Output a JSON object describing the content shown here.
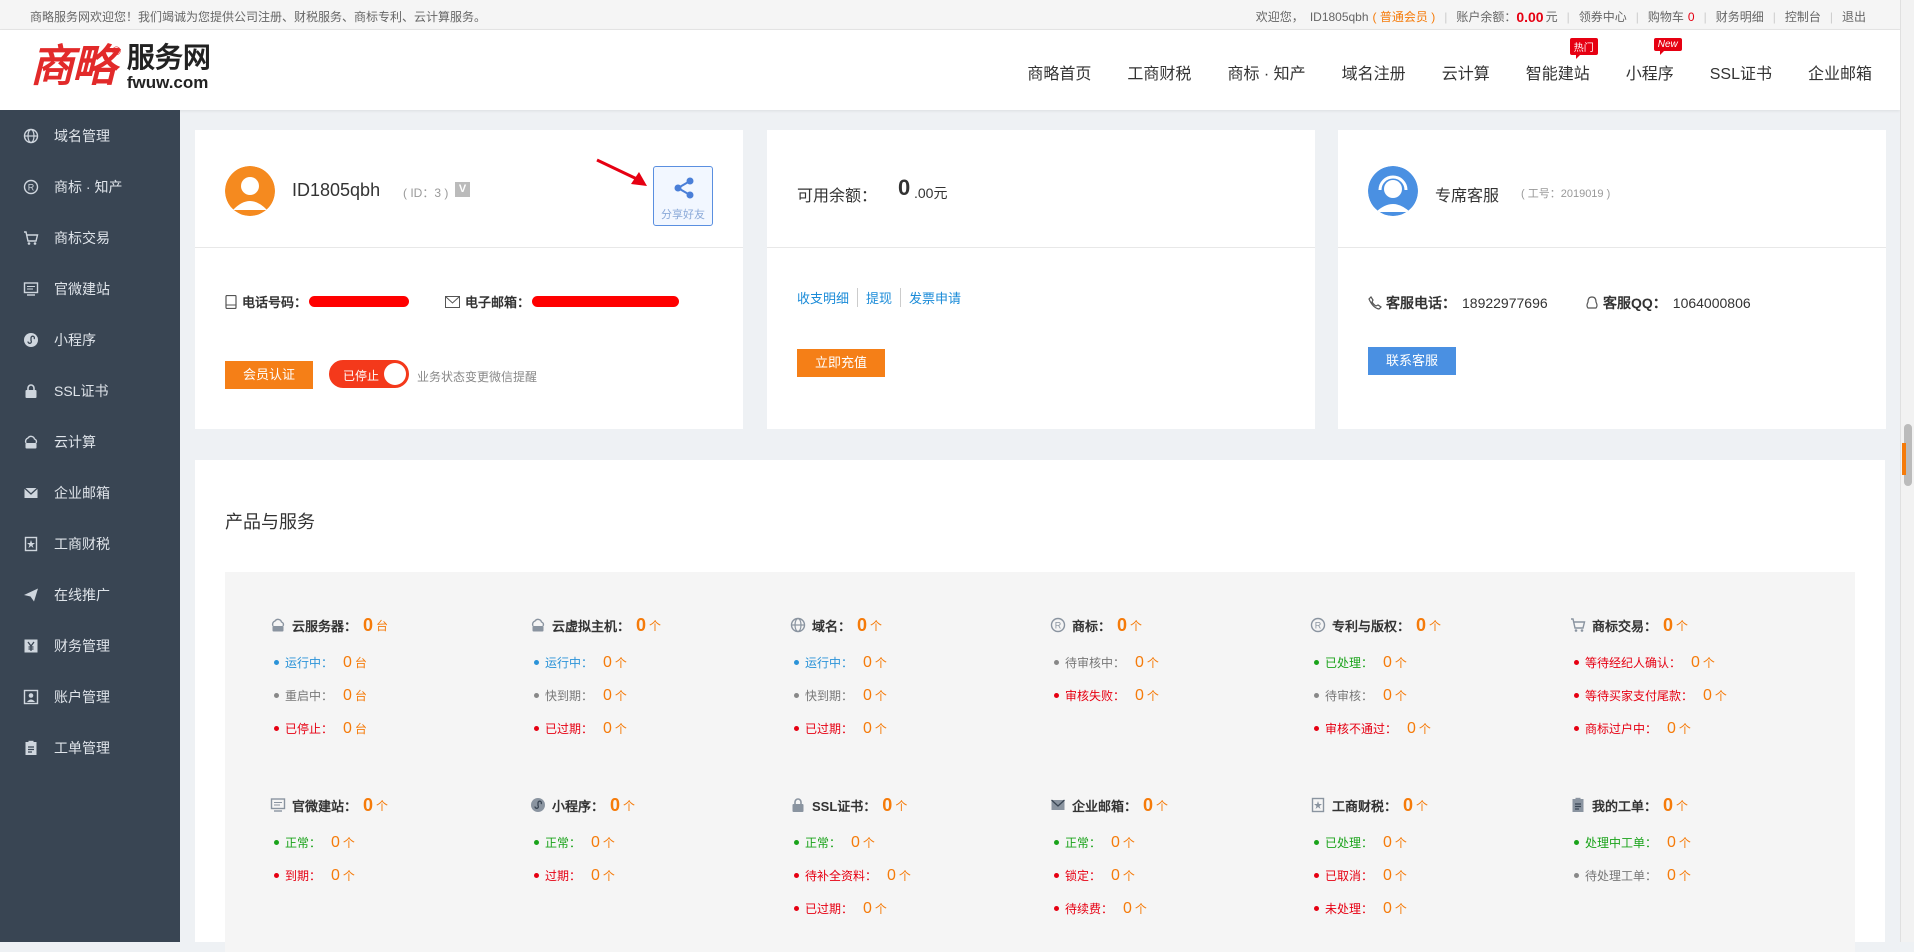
{
  "topbar": {
    "welcome": "商略服务网欢迎您！我们竭诚为您提供公司注册、财税服务、商标专利、云计算服务。",
    "hello": "欢迎您，",
    "user": "ID1805qbh",
    "member": "( 普通会员 )",
    "balance_label": "账户余额：",
    "balance_value": "0.00",
    "balance_unit": "元",
    "coupon": "领券中心",
    "cart": "购物车",
    "cart_count": "0",
    "finance": "财务明细",
    "console": "控制台",
    "logout": "退出"
  },
  "logo": {
    "mark": "商略",
    "reg": "®",
    "cn": "服务网",
    "en": "fwuw.com"
  },
  "nav": [
    {
      "label": "商略首页"
    },
    {
      "label": "工商财税"
    },
    {
      "label": "商标 · 知产"
    },
    {
      "label": "域名注册"
    },
    {
      "label": "云计算"
    },
    {
      "label": "智能建站",
      "badge": "热门"
    },
    {
      "label": "小程序",
      "badge": "New"
    },
    {
      "label": "SSL证书"
    },
    {
      "label": "企业邮箱"
    }
  ],
  "sidebar": [
    {
      "label": "域名管理",
      "icon": "globe-icon"
    },
    {
      "label": "商标 · 知产",
      "icon": "registered-icon"
    },
    {
      "label": "商标交易",
      "icon": "cart-icon"
    },
    {
      "label": "官微建站",
      "icon": "monitor-icon"
    },
    {
      "label": "小程序",
      "icon": "miniprogram-icon"
    },
    {
      "label": "SSL证书",
      "icon": "lock-icon"
    },
    {
      "label": "云计算",
      "icon": "cloud-server-icon"
    },
    {
      "label": "企业邮箱",
      "icon": "mail-icon"
    },
    {
      "label": "工商财税",
      "icon": "tax-icon"
    },
    {
      "label": "在线推广",
      "icon": "send-icon"
    },
    {
      "label": "财务管理",
      "icon": "yen-icon"
    },
    {
      "label": "账户管理",
      "icon": "account-icon"
    },
    {
      "label": "工单管理",
      "icon": "ticket-icon"
    }
  ],
  "user_card": {
    "name": "ID1805qbh",
    "id_text": "( ID：3 )",
    "v_badge": "V",
    "share_label": "分享好友",
    "phone_label": "电话号码：",
    "email_label": "电子邮箱：",
    "verify_btn": "会员认证",
    "toggle_label": "已停止",
    "toggle_note": "业务状态变更微信提醒"
  },
  "balance_card": {
    "label": "可用余额：",
    "value_int": "0",
    "value_dec": ".00元",
    "links": [
      "收支明细",
      "提现",
      "发票申请"
    ],
    "recharge_btn": "立即充值"
  },
  "service_card": {
    "title": "专席客服",
    "work_no": "( 工号：2019019 )",
    "phone_label": "客服电话：",
    "phone": "18922977696",
    "qq_label": "客服QQ：",
    "qq": "1064000806",
    "contact_btn": "联系客服"
  },
  "products": {
    "title": "产品与服务",
    "rows": [
      [
        {
          "icon": "cloud-server-icon",
          "name": "云服务器：",
          "count": "0",
          "unit": "台",
          "items": [
            {
              "label": "运行中：",
              "value": "0",
              "unit": "台",
              "color": "blue"
            },
            {
              "label": "重启中：",
              "value": "0",
              "unit": "台",
              "color": "gray"
            },
            {
              "label": "已停止：",
              "value": "0",
              "unit": "台",
              "color": "red"
            }
          ]
        },
        {
          "icon": "virtual-host-icon",
          "name": "云虚拟主机：",
          "count": "0",
          "unit": "个",
          "items": [
            {
              "label": "运行中：",
              "value": "0",
              "unit": "个",
              "color": "blue"
            },
            {
              "label": "快到期：",
              "value": "0",
              "unit": "个",
              "color": "gray"
            },
            {
              "label": "已过期：",
              "value": "0",
              "unit": "个",
              "color": "red"
            }
          ]
        },
        {
          "icon": "globe-icon",
          "name": "域名：",
          "count": "0",
          "unit": "个",
          "items": [
            {
              "label": "运行中：",
              "value": "0",
              "unit": "个",
              "color": "blue"
            },
            {
              "label": "快到期：",
              "value": "0",
              "unit": "个",
              "color": "gray"
            },
            {
              "label": "已过期：",
              "value": "0",
              "unit": "个",
              "color": "red"
            }
          ]
        },
        {
          "icon": "registered-icon",
          "name": "商标：",
          "count": "0",
          "unit": "个",
          "items": [
            {
              "label": "待审核中：",
              "value": "0",
              "unit": "个",
              "color": "gray"
            },
            {
              "label": "审核失败：",
              "value": "0",
              "unit": "个",
              "color": "red"
            }
          ]
        },
        {
          "icon": "registered-icon",
          "name": "专利与版权：",
          "count": "0",
          "unit": "个",
          "items": [
            {
              "label": "已处理：",
              "value": "0",
              "unit": "个",
              "color": "green"
            },
            {
              "label": "待审核：",
              "value": "0",
              "unit": "个",
              "color": "gray"
            },
            {
              "label": "审核不通过：",
              "value": "0",
              "unit": "个",
              "color": "red"
            }
          ]
        },
        {
          "icon": "cart-icon",
          "name": "商标交易：",
          "count": "0",
          "unit": "个",
          "items": [
            {
              "label": "等待经纪人确认：",
              "value": "0",
              "unit": "个",
              "color": "red"
            },
            {
              "label": "等待买家支付尾款：",
              "value": "0",
              "unit": "个",
              "color": "red"
            },
            {
              "label": "商标过户中：",
              "value": "0",
              "unit": "个",
              "color": "red"
            }
          ]
        }
      ],
      [
        {
          "icon": "monitor-icon",
          "name": "官微建站：",
          "count": "0",
          "unit": "个",
          "items": [
            {
              "label": "正常：",
              "value": "0",
              "unit": "个",
              "color": "green"
            },
            {
              "label": "到期：",
              "value": "0",
              "unit": "个",
              "color": "red"
            }
          ]
        },
        {
          "icon": "miniprogram-icon",
          "name": "小程序：",
          "count": "0",
          "unit": "个",
          "items": [
            {
              "label": "正常：",
              "value": "0",
              "unit": "个",
              "color": "green"
            },
            {
              "label": "过期：",
              "value": "0",
              "unit": "个",
              "color": "red"
            }
          ]
        },
        {
          "icon": "lock-icon",
          "name": "SSL证书：",
          "count": "0",
          "unit": "个",
          "items": [
            {
              "label": "正常：",
              "value": "0",
              "unit": "个",
              "color": "green"
            },
            {
              "label": "待补全资料：",
              "value": "0",
              "unit": "个",
              "color": "red"
            },
            {
              "label": "已过期：",
              "value": "0",
              "unit": "个",
              "color": "red"
            }
          ]
        },
        {
          "icon": "mail-icon",
          "name": "企业邮箱：",
          "count": "0",
          "unit": "个",
          "items": [
            {
              "label": "正常：",
              "value": "0",
              "unit": "个",
              "color": "green"
            },
            {
              "label": "锁定：",
              "value": "0",
              "unit": "个",
              "color": "red"
            },
            {
              "label": "待续费：",
              "value": "0",
              "unit": "个",
              "color": "red"
            }
          ]
        },
        {
          "icon": "tax-icon",
          "name": "工商财税：",
          "count": "0",
          "unit": "个",
          "items": [
            {
              "label": "已处理：",
              "value": "0",
              "unit": "个",
              "color": "green"
            },
            {
              "label": "已取消：",
              "value": "0",
              "unit": "个",
              "color": "red"
            },
            {
              "label": "未处理：",
              "value": "0",
              "unit": "个",
              "color": "red"
            }
          ]
        },
        {
          "icon": "ticket-icon",
          "name": "我的工单：",
          "count": "0",
          "unit": "个",
          "items": [
            {
              "label": "处理中工单：",
              "value": "0",
              "unit": "个",
              "color": "green"
            },
            {
              "label": "待处理工单：",
              "value": "0",
              "unit": "个",
              "color": "gray"
            }
          ]
        }
      ]
    ]
  }
}
